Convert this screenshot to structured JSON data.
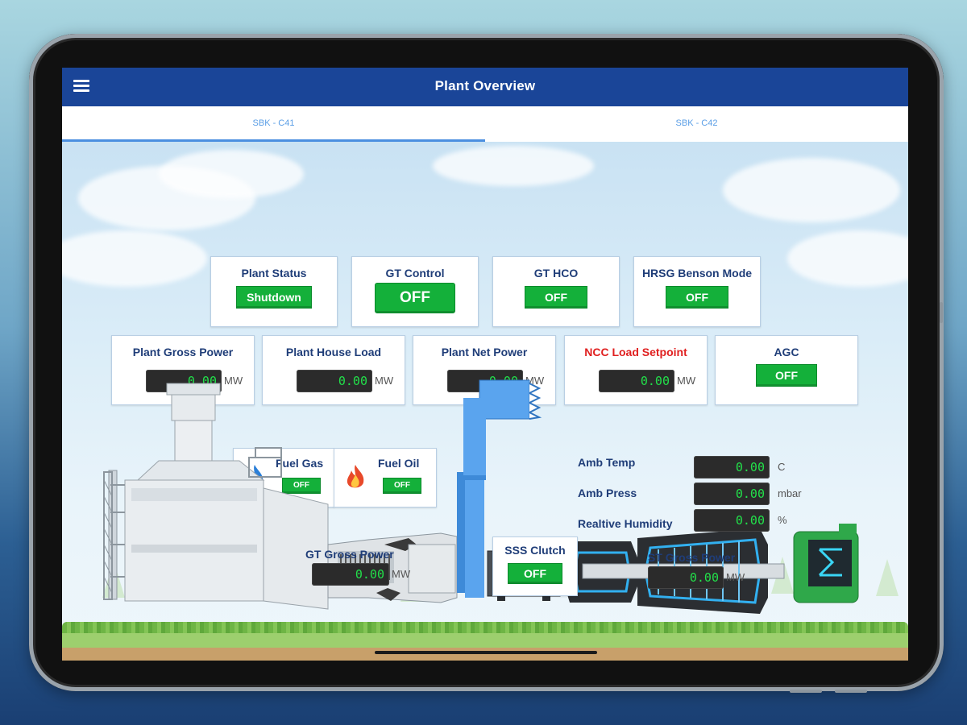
{
  "app": {
    "title": "Plant Overview"
  },
  "tabs": [
    {
      "label": "SBK - C41",
      "active": true
    },
    {
      "label": "SBK - C42",
      "active": false
    }
  ],
  "status_cards": {
    "plant_status": {
      "label": "Plant Status",
      "value": "Shutdown"
    },
    "gt_control": {
      "label": "GT Control",
      "value": "OFF"
    },
    "gt_hco": {
      "label": "GT HCO",
      "value": "OFF"
    },
    "hrsg_benson": {
      "label": "HRSG Benson Mode",
      "value": "OFF"
    }
  },
  "power_cards": {
    "gross": {
      "label": "Plant Gross Power",
      "value": "0.00",
      "unit": "MW"
    },
    "house": {
      "label": "Plant House Load",
      "value": "0.00",
      "unit": "MW"
    },
    "net": {
      "label": "Plant Net Power",
      "value": "0.00",
      "unit": "MW"
    },
    "ncc": {
      "label": "NCC Load Setpoint",
      "value": "0.00",
      "unit": "MW"
    },
    "agc": {
      "label": "AGC",
      "value": "OFF"
    }
  },
  "fuel": {
    "gas": {
      "label": "Fuel Gas",
      "value": "OFF"
    },
    "oil": {
      "label": "Fuel Oil",
      "value": "OFF"
    }
  },
  "gt_gross": {
    "label": "GT Gross Power",
    "value": "0.00",
    "unit": "MW"
  },
  "sss_clutch": {
    "label": "SSS Clutch",
    "value": "OFF"
  },
  "st_gross": {
    "label": "ST Gross Power",
    "value": "0.00",
    "unit": "MW"
  },
  "ambient": {
    "temp": {
      "label": "Amb Temp",
      "value": "0.00",
      "unit": "C"
    },
    "press": {
      "label": "Amb Press",
      "value": "0.00",
      "unit": "mbar"
    },
    "humidity": {
      "label": "Realtive Humidity",
      "value": "0.00",
      "unit": "%"
    }
  },
  "colors": {
    "appbar": "#1a4598",
    "accent_green": "#14b03a",
    "value_green": "#22e04a",
    "label_navy": "#1f3d78",
    "ncc_red": "#e02020",
    "tab_blue": "#5a9ee6"
  },
  "icons": [
    "menu-icon",
    "gas-flame-icon",
    "oil-flame-icon"
  ]
}
